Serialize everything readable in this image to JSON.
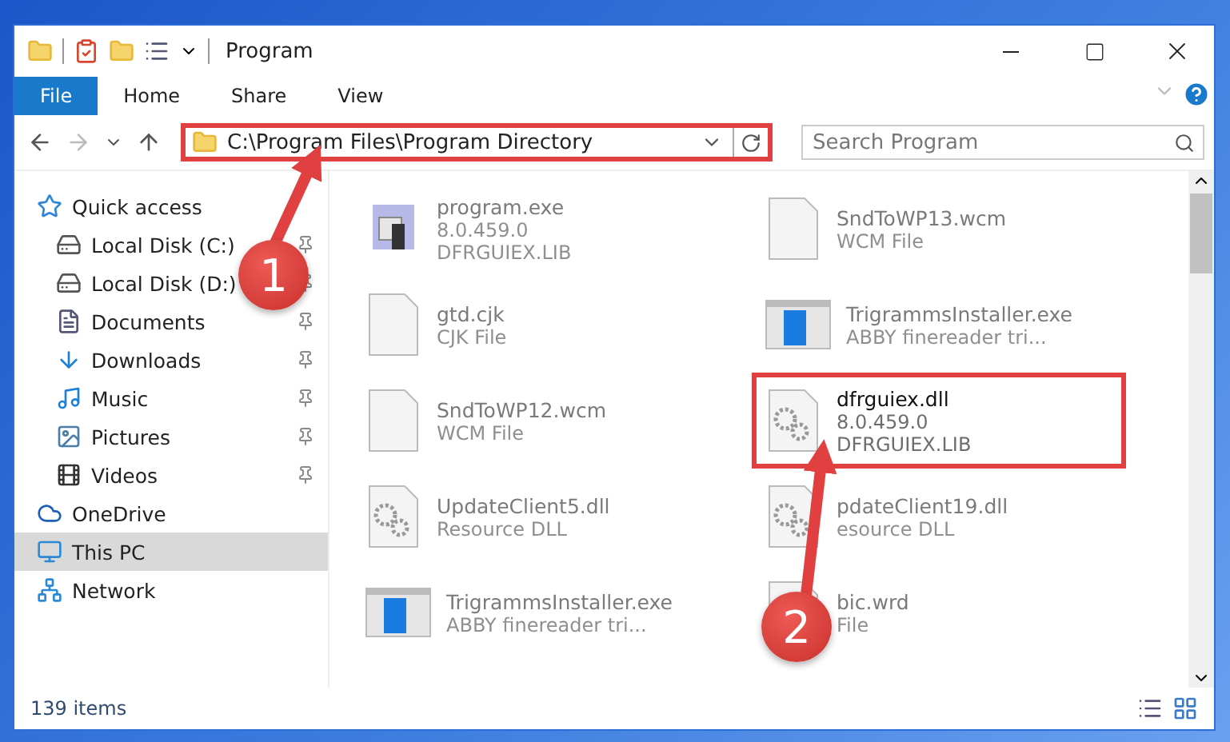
{
  "window": {
    "title": "Program"
  },
  "ribbon": {
    "tabs": [
      {
        "label": "File",
        "selected": true
      },
      {
        "label": "Home",
        "selected": false
      },
      {
        "label": "Share",
        "selected": false
      },
      {
        "label": "View",
        "selected": false
      }
    ]
  },
  "address": {
    "path": "C:\\Program Files\\Program Directory",
    "highlighted": true
  },
  "search": {
    "placeholder": "Search Program"
  },
  "nav": [
    {
      "label": "Quick access",
      "kind": "star",
      "pinned": false,
      "selected": false,
      "children": [
        {
          "label": "Local Disk (C:)",
          "kind": "drive",
          "pinned": true,
          "selected": false
        },
        {
          "label": "Local Disk (D:)",
          "kind": "drive",
          "pinned": true,
          "selected": false
        },
        {
          "label": "Documents",
          "kind": "document",
          "pinned": true,
          "selected": false
        },
        {
          "label": "Downloads",
          "kind": "download",
          "pinned": true,
          "selected": false
        },
        {
          "label": "Music",
          "kind": "music",
          "pinned": true,
          "selected": false
        },
        {
          "label": "Pictures",
          "kind": "pictures",
          "pinned": true,
          "selected": false
        },
        {
          "label": "Videos",
          "kind": "videos",
          "pinned": true,
          "selected": false
        }
      ]
    },
    {
      "label": "OneDrive",
      "kind": "cloud",
      "pinned": false,
      "selected": false
    },
    {
      "label": "This PC",
      "kind": "computer",
      "pinned": false,
      "selected": true
    },
    {
      "label": "Network",
      "kind": "network",
      "pinned": false,
      "selected": false
    }
  ],
  "files": [
    {
      "name": "program.exe",
      "lines": [
        "8.0.459.0",
        "DFRGUIEX.LIB"
      ],
      "kind": "app",
      "highlighted": false
    },
    {
      "name": "SndToWP13.wcm",
      "lines": [
        "WCM File"
      ],
      "kind": "blank",
      "highlighted": false
    },
    {
      "name": "gtd.cjk",
      "lines": [
        "CJK File"
      ],
      "kind": "blank",
      "highlighted": false
    },
    {
      "name": "TrigrammsInstaller.exe",
      "lines": [
        "ABBY finereader tri..."
      ],
      "kind": "installer",
      "highlighted": false
    },
    {
      "name": "SndToWP12.wcm",
      "lines": [
        "WCM File"
      ],
      "kind": "blank",
      "highlighted": false
    },
    {
      "name": "dfrguiex.dll",
      "lines": [
        "8.0.459.0",
        "DFRGUIEX.LIB"
      ],
      "kind": "gear",
      "highlighted": true
    },
    {
      "name": "UpdateClient5.dll",
      "lines": [
        "Resource DLL"
      ],
      "kind": "gear",
      "highlighted": false
    },
    {
      "name": "pdateClient19.dll",
      "lines": [
        "esource DLL"
      ],
      "kind": "gear",
      "highlighted": false
    },
    {
      "name": "TrigrammsInstaller.exe",
      "lines": [
        "ABBY finereader tri..."
      ],
      "kind": "installer",
      "highlighted": false
    },
    {
      "name": "bic.wrd",
      "lines": [
        "File"
      ],
      "kind": "blank",
      "highlighted": false
    }
  ],
  "status": {
    "count": "139 items"
  },
  "annotations": [
    {
      "number": "1"
    },
    {
      "number": "2"
    }
  ]
}
